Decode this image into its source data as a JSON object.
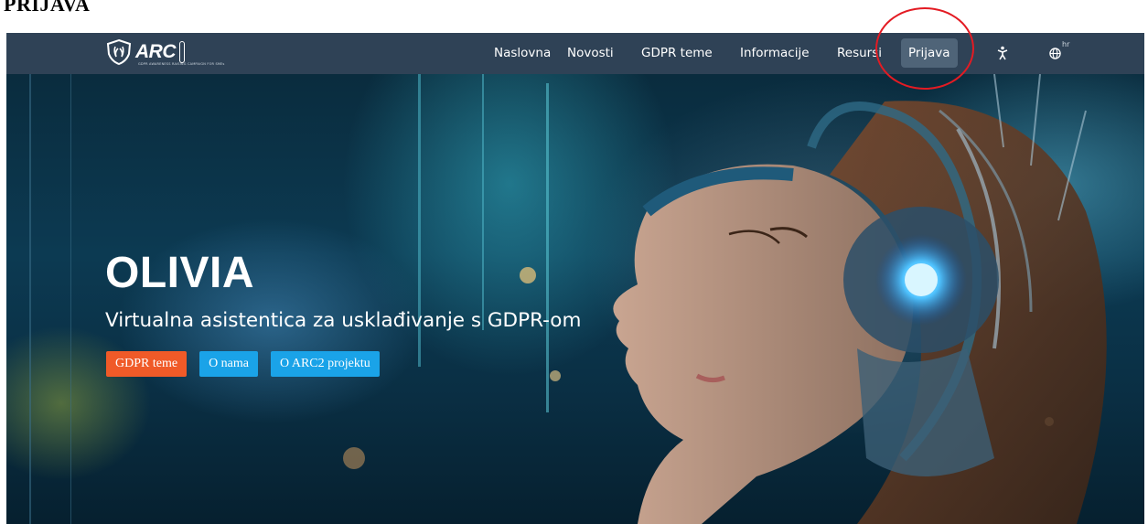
{
  "document": {
    "heading": "PRIJAVA"
  },
  "navbar": {
    "logo_text": "ARC",
    "logo_subtext": "GDPR AWARENESS RAISING CAMPAIGN FOR SMEs",
    "items": [
      {
        "label": "Naslovna"
      },
      {
        "label": "Novosti"
      },
      {
        "label": "GDPR teme"
      },
      {
        "label": "Informacije"
      },
      {
        "label": "Resursi"
      },
      {
        "label": "Prijava"
      }
    ],
    "active_item": "Prijava",
    "accessibility_icon": "accessibility-icon",
    "language_icon": "globe-icon",
    "language_code": "hr"
  },
  "hero": {
    "title": "OLIVIA",
    "subtitle": "Virtualna asistentica za usklađivanje s GDPR-om",
    "buttons": [
      {
        "label": "GDPR teme",
        "color": "#f05a28"
      },
      {
        "label": "O nama",
        "color": "#1aa3e8"
      },
      {
        "label": "O ARC2 projektu",
        "color": "#1aa3e8"
      }
    ]
  },
  "colors": {
    "navbar_bg": "#2f4256",
    "active_nav_bg": "#4f6478",
    "annotation": "#e31b23"
  }
}
